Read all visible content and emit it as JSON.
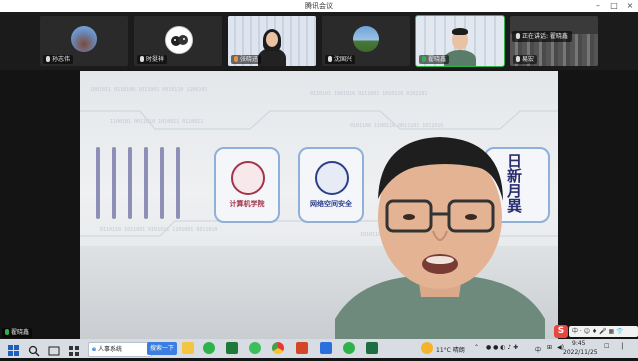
{
  "window": {
    "title": "腾讯会议"
  },
  "strip": {
    "participants": [
      {
        "name": "孙志伟",
        "muted": true
      },
      {
        "name": "时挺祥",
        "muted": true
      },
      {
        "name": "张晓迅",
        "muted": false
      },
      {
        "name": "沈国兴",
        "muted": true
      },
      {
        "name": "翟晓鑫",
        "muted": true
      },
      {
        "name": "易宏",
        "muted": true
      }
    ],
    "speaking_label": "正在讲话: 翟晓鑫"
  },
  "stage": {
    "logo_left_label": "计算机学院",
    "logo_mid_label": "网络空间安全",
    "calligraphy": "日新月異",
    "speaker_name": "翟晓鑫"
  },
  "taskbar": {
    "search_text": "人事系统",
    "search_button": "搜索一下",
    "weather": "11°C 晴朗",
    "ime": "中",
    "time": "9:45",
    "date": "2022/11/25",
    "ime_bar": "中 · ☺ ♦ 🎤 ▦ 👕"
  },
  "colors": {
    "accent_green": "#2fb24a",
    "stage_bg": "#e4e7ea",
    "taskbar_bg": "#d8dde4"
  }
}
